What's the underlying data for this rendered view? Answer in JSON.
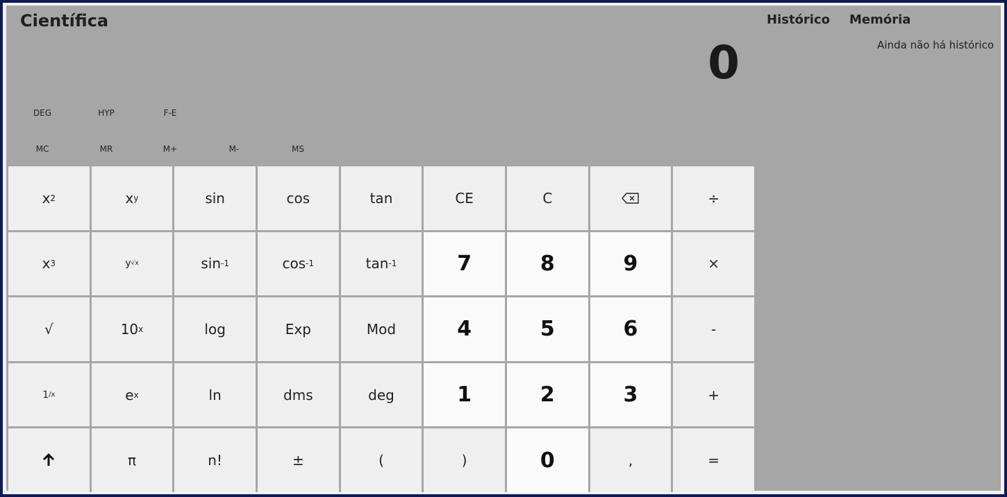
{
  "app": {
    "mode_title": "Científica",
    "display_value": "0"
  },
  "mode_buttons": [
    "DEG",
    "HYP",
    "F-E"
  ],
  "memory_buttons": [
    "MC",
    "MR",
    "M+",
    "M-",
    "MS"
  ],
  "side_panel": {
    "tab_history": "Histórico",
    "tab_memory": "Memória",
    "empty_history": "Ainda não há histórico"
  },
  "keys": {
    "r1": {
      "x2_base": "x",
      "x2_sup": "2",
      "xy_base": "x",
      "xy_sup": "y",
      "sin": "sin",
      "cos": "cos",
      "tan": "tan",
      "ce": "CE",
      "c": "C",
      "divide": "÷"
    },
    "r2": {
      "x3_base": "x",
      "x3_sup": "3",
      "root_y": "y",
      "root_sup": "√x",
      "asin": "sin",
      "acos": "cos",
      "atan": "tan",
      "inv_sup": "-1",
      "seven": "7",
      "eight": "8",
      "nine": "9",
      "multiply": "×"
    },
    "r3": {
      "sqrt": "√",
      "ten_base": "10",
      "ten_sup": "x",
      "log": "log",
      "exp": "Exp",
      "mod": "Mod",
      "four": "4",
      "five": "5",
      "six": "6",
      "minus": "-"
    },
    "r4": {
      "recip_one": "1",
      "recip_sup": "/x",
      "e_base": "e",
      "e_sup": "x",
      "ln": "ln",
      "dms": "dms",
      "deg": "deg",
      "one": "1",
      "two": "2",
      "three": "3",
      "plus": "+"
    },
    "r5": {
      "pi": "π",
      "fact": "n!",
      "sign": "±",
      "lparen": "(",
      "rparen": ")",
      "zero": "0",
      "comma": ",",
      "equals": "="
    }
  }
}
